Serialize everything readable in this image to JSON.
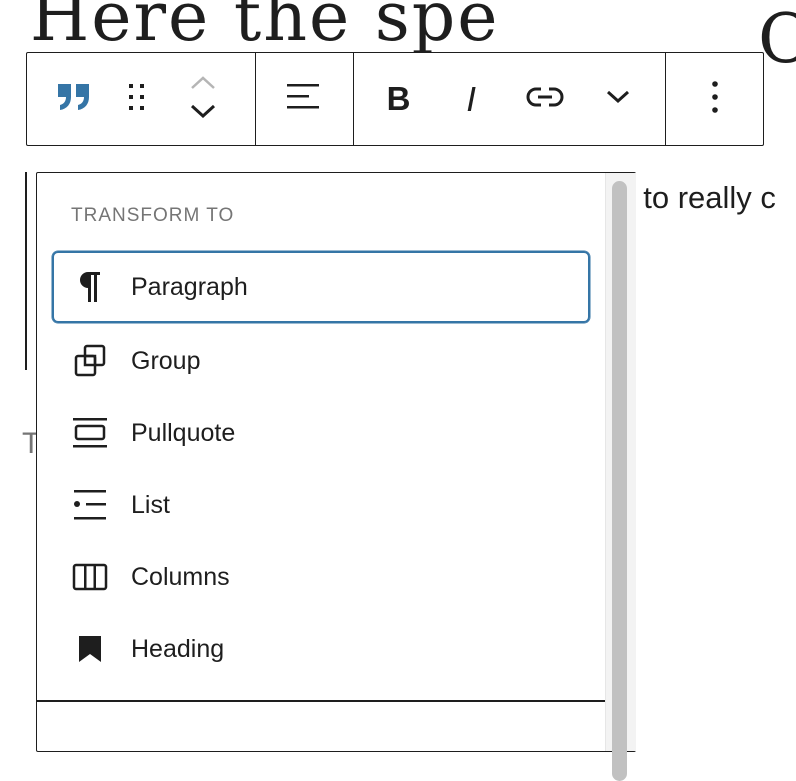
{
  "background": {
    "heading_left": "Here the spe",
    "heading_right": "O",
    "paragraph_fragment": "t to really c",
    "stray_char": "T"
  },
  "toolbar": {
    "block_type_icon": "quote-icon",
    "drag_icon": "drag-handle-icon",
    "move_up_icon": "chevron-up-icon",
    "move_down_icon": "chevron-down-icon",
    "align_icon": "align-left-icon",
    "bold_label": "B",
    "italic_label": "I",
    "link_icon": "link-icon",
    "more_formats_icon": "chevron-down-icon",
    "options_icon": "more-vertical-icon",
    "accent_color": "#3575a6"
  },
  "transform_menu": {
    "heading": "TRANSFORM TO",
    "items": [
      {
        "label": "Paragraph",
        "icon": "paragraph-icon",
        "active": true
      },
      {
        "label": "Group",
        "icon": "group-icon",
        "active": false
      },
      {
        "label": "Pullquote",
        "icon": "pullquote-icon",
        "active": false
      },
      {
        "label": "List",
        "icon": "list-icon",
        "active": false
      },
      {
        "label": "Columns",
        "icon": "columns-icon",
        "active": false
      },
      {
        "label": "Heading",
        "icon": "bookmark-icon",
        "active": false
      }
    ],
    "focus_color": "#3575a6"
  }
}
